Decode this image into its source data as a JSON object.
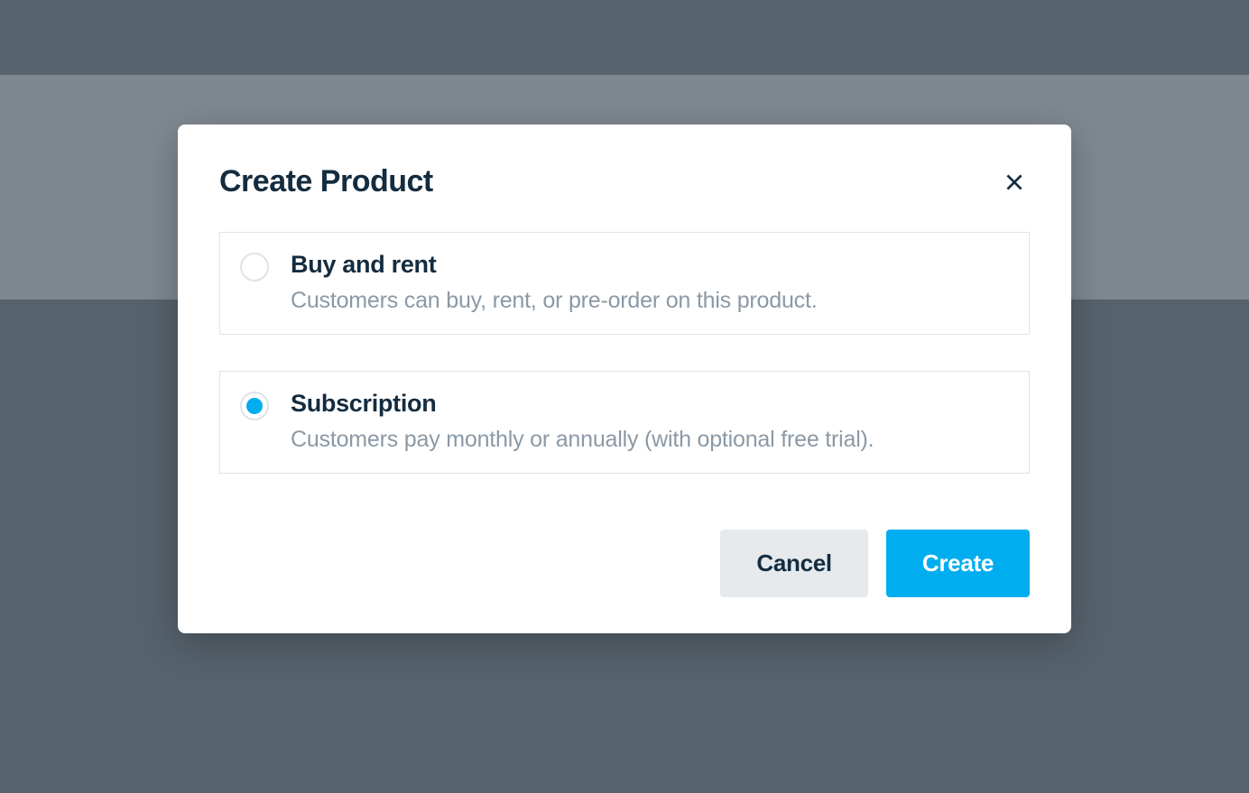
{
  "modal": {
    "title": "Create Product",
    "options": [
      {
        "title": "Buy and rent",
        "description": "Customers can buy, rent, or pre-order on this product.",
        "selected": false
      },
      {
        "title": "Subscription",
        "description": "Customers pay monthly or annually (with optional free trial).",
        "selected": true
      }
    ],
    "buttons": {
      "cancel": "Cancel",
      "create": "Create"
    }
  },
  "colors": {
    "primary": "#00aeef",
    "text_dark": "#142c3f",
    "text_muted": "#8b99a6",
    "border": "#dde3e8",
    "btn_secondary_bg": "#e6eaed",
    "backdrop": "#7c8791"
  }
}
